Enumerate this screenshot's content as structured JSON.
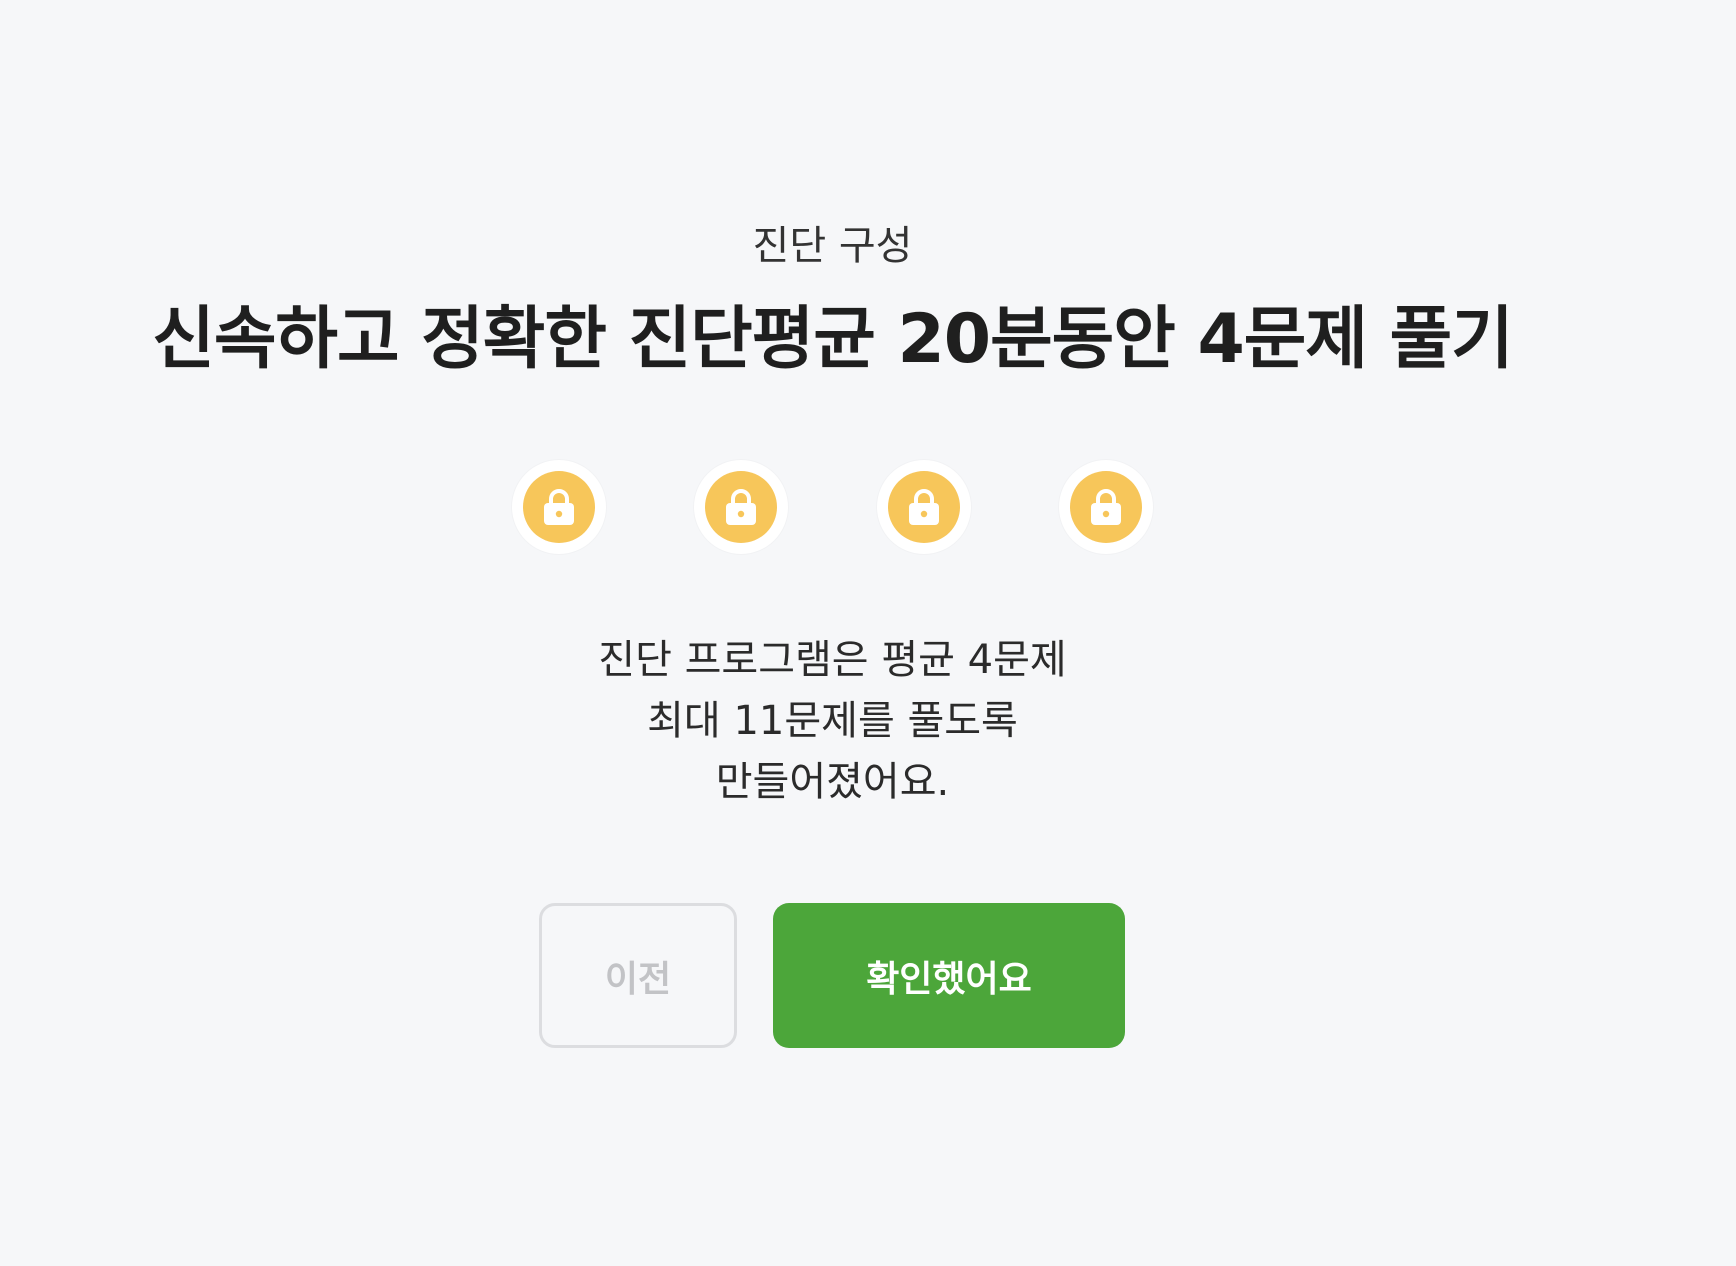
{
  "eyebrow": "진단 구성",
  "headline": "신속하고 정확한 진단평균 20분동안 4문제 풀기",
  "locks": {
    "count": 4,
    "icon": "lock-icon",
    "color": "#f7c65a"
  },
  "description": {
    "line1": "진단 프로그램은 평균 4문제",
    "line2": "최대 11문제를 풀도록",
    "line3": "만들어졌어요."
  },
  "buttons": {
    "prev_label": "이전",
    "confirm_label": "확인했어요",
    "confirm_color": "#4ca63a"
  }
}
